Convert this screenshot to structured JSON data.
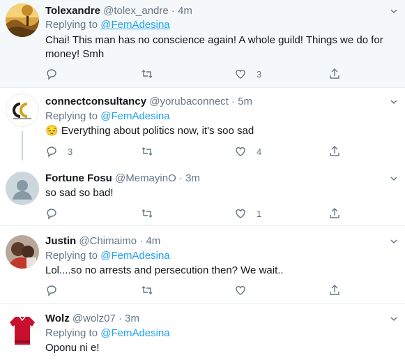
{
  "replying_label": "Replying to",
  "tweets": [
    {
      "name": "Tolexandre",
      "handle": "@tolex_andre",
      "dot": "·",
      "time": "4m",
      "reply_to": "@FemAdesina",
      "text": "Chai! This man has no conscience again! A whole guild! Things we do for money! Smh",
      "replies": "",
      "retweets": "",
      "likes": "3"
    },
    {
      "name": "connectconsultancy",
      "handle": "@yorubaconnect",
      "dot": "·",
      "time": "5m",
      "reply_to": "@FemAdesina",
      "emoji": "😔",
      "text": "Everything about politics now, it's soo sad",
      "replies": "3",
      "retweets": "",
      "likes": "4"
    },
    {
      "name": "Fortune Fosu",
      "handle": "@MemayinO",
      "dot": "·",
      "time": "3m",
      "text": "so sad so bad!",
      "replies": "",
      "retweets": "",
      "likes": "1"
    },
    {
      "name": "Justin",
      "handle": "@Chimaimo",
      "dot": "·",
      "time": "4m",
      "reply_to": "@FemAdesina",
      "text": "Lol....so no arrests and persecution then? We wait..",
      "replies": "",
      "retweets": "",
      "likes": ""
    },
    {
      "name": "Wolz",
      "handle": "@wolz07",
      "dot": "·",
      "time": "3m",
      "reply_to": "@FemAdesina",
      "text": "Oponu ni e!"
    }
  ],
  "colors": {
    "link": "#1da1f2",
    "muted": "#657786",
    "highlight_bg": "#f5f8fa"
  },
  "icons": [
    "reply-icon",
    "retweet-icon",
    "like-icon",
    "share-icon",
    "caret-down-icon"
  ]
}
